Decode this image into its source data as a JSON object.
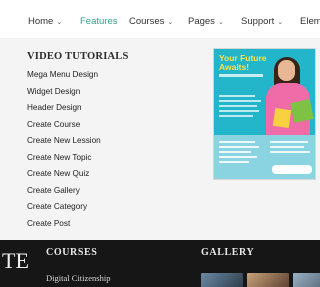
{
  "nav": {
    "items": [
      {
        "label": "Home",
        "has_dropdown": true
      },
      {
        "label": "Features",
        "has_dropdown": false,
        "active": true
      },
      {
        "label": "Courses",
        "has_dropdown": true
      },
      {
        "label": "Pages",
        "has_dropdown": true
      },
      {
        "label": "Support",
        "has_dropdown": true
      },
      {
        "label": "Eleme",
        "has_dropdown": false
      }
    ],
    "chevron_icon": "chevron-down-icon",
    "active_color": "#2fa38a"
  },
  "mega_menu": {
    "title": "VIDEO TUTORIALS",
    "items": [
      "Mega Menu Design",
      "Widget Design",
      "Header Design",
      "Create Course",
      "Create New Lession",
      "Create New Topic",
      "Create New Quiz",
      "Create Gallery",
      "Create Category",
      "Create Post"
    ],
    "promo": {
      "title": "Your Future Awaits!",
      "accent_color": "#23b5c9",
      "title_color": "#ffe24a"
    }
  },
  "footer": {
    "big_text": "TE",
    "courses_heading": "COURSES",
    "gallery_heading": "GALLERY",
    "course_link": "Digital Citizenship"
  }
}
